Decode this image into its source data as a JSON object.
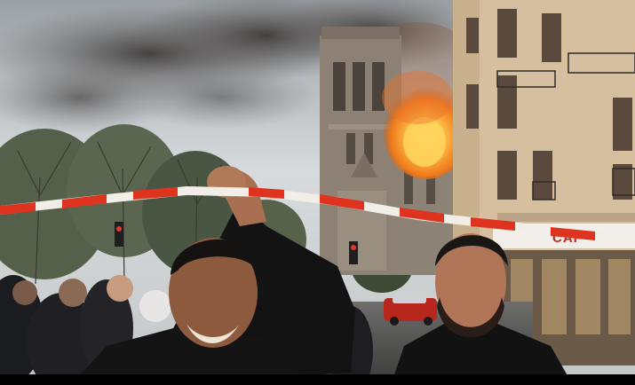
{
  "scene": {
    "signage": {
      "cafe_text": "CAF"
    },
    "colors": {
      "sky": "#cfd4d9",
      "smoke": "#5e5a58",
      "fire": "#ff8a1e",
      "fire_core": "#ffd35a",
      "cathedral_stone": "#8f8478",
      "building_facade": "#d9c2a4",
      "tape_red": "#e0321e",
      "tape_white": "#f2efe9",
      "jacket": "#151515",
      "skin": "#b07a58",
      "trees": "#4f5d3f",
      "cafe_awning": "#f4f1ec",
      "car": "#b8271e"
    }
  }
}
